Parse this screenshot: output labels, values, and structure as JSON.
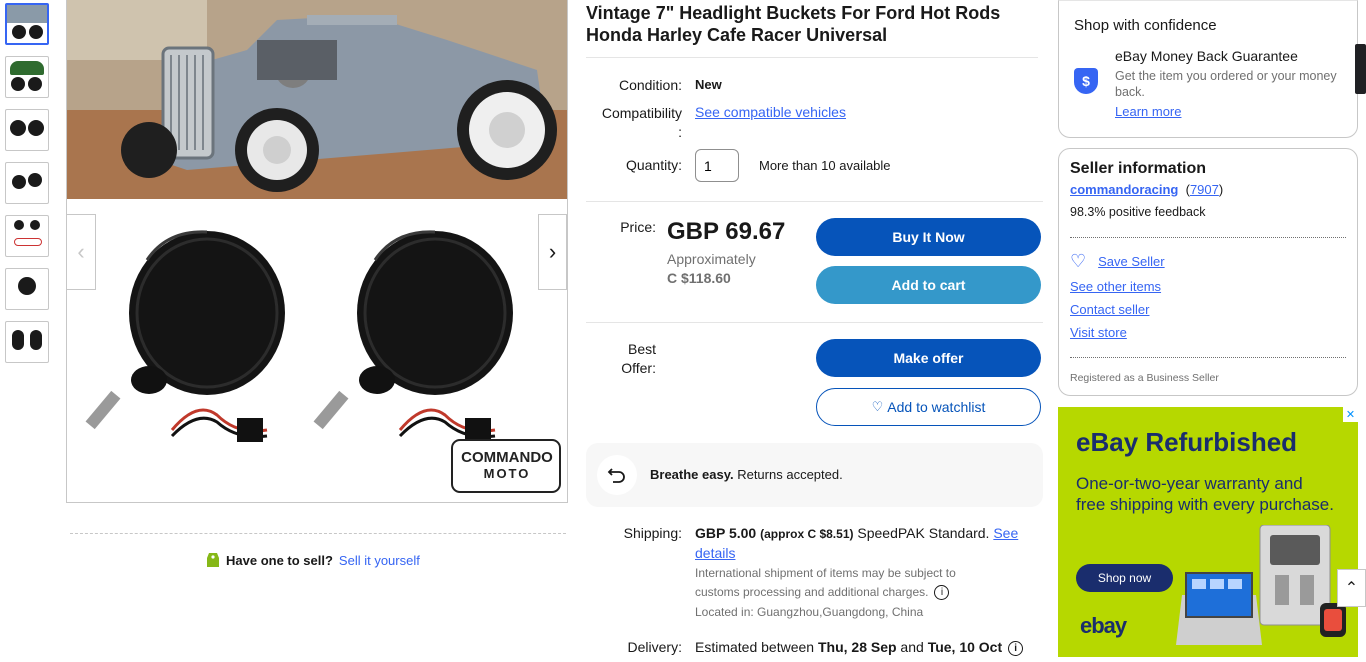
{
  "listing": {
    "title": "Vintage 7\" Headlight Buckets For Ford Hot Rods Honda Harley Cafe Racer Universal",
    "condition_label": "Condition:",
    "condition_value": "New",
    "compat_label": "Compatibility",
    "compat_colon": ":",
    "compat_link": "See compatible vehicles",
    "quantity_label": "Quantity:",
    "quantity_value": "1",
    "availability": "More than 10 available",
    "price_label": "Price:",
    "price": "GBP 69.67",
    "approx_label": "Approximately",
    "approx_value": "C $118.60",
    "buy_now": "Buy It Now",
    "add_to_cart": "Add to cart",
    "best_offer_label_1": "Best",
    "best_offer_label_2": "Offer:",
    "make_offer": "Make offer",
    "add_to_watchlist": "Add to watchlist"
  },
  "returns": {
    "bold": "Breathe easy.",
    "text": " Returns accepted."
  },
  "shipping": {
    "label": "Shipping:",
    "cost": "GBP 5.00",
    "approx": "(approx C $8.51)",
    "method": " SpeedPAK Standard.",
    "details_link_1": "See",
    "details_link_2": "details",
    "intl_note": "International shipment of items may be subject to customs processing and additional charges.",
    "located": "Located in: Guangzhou,Guangdong, China"
  },
  "delivery": {
    "label": "Delivery:",
    "prefix": "Estimated between ",
    "start": "Thu, 28 Sep",
    "and": " and ",
    "end": "Tue, 10 Oct"
  },
  "gallery": {
    "watermark_1": "COMMANDO",
    "watermark_2": "MOTO",
    "thumb_count": 7
  },
  "sell": {
    "question": "Have one to sell?",
    "link": "Sell it yourself"
  },
  "confidence": {
    "heading": "Shop with confidence",
    "mbg_title": "eBay Money Back Guarantee",
    "mbg_desc": "Get the item you ordered or your money back.",
    "mbg_link": "Learn more"
  },
  "seller": {
    "heading": "Seller information",
    "name": "commandoracing",
    "score": "7907",
    "feedback": "98.3% positive feedback",
    "save": "Save Seller",
    "other_items": "See other items",
    "contact": "Contact seller",
    "visit": "Visit store",
    "registered": "Registered as a Business Seller"
  },
  "ad": {
    "title": "eBay Refurbished",
    "subtitle": "One-or-two-year warranty and free shipping with every purchase.",
    "cta": "Shop now",
    "logo": "ebay",
    "close": "✕"
  },
  "colors": {
    "accent": "#3665f3",
    "primary_btn": "#0654ba",
    "cart_btn": "#3498ca",
    "ad_bg": "#b6d800"
  }
}
